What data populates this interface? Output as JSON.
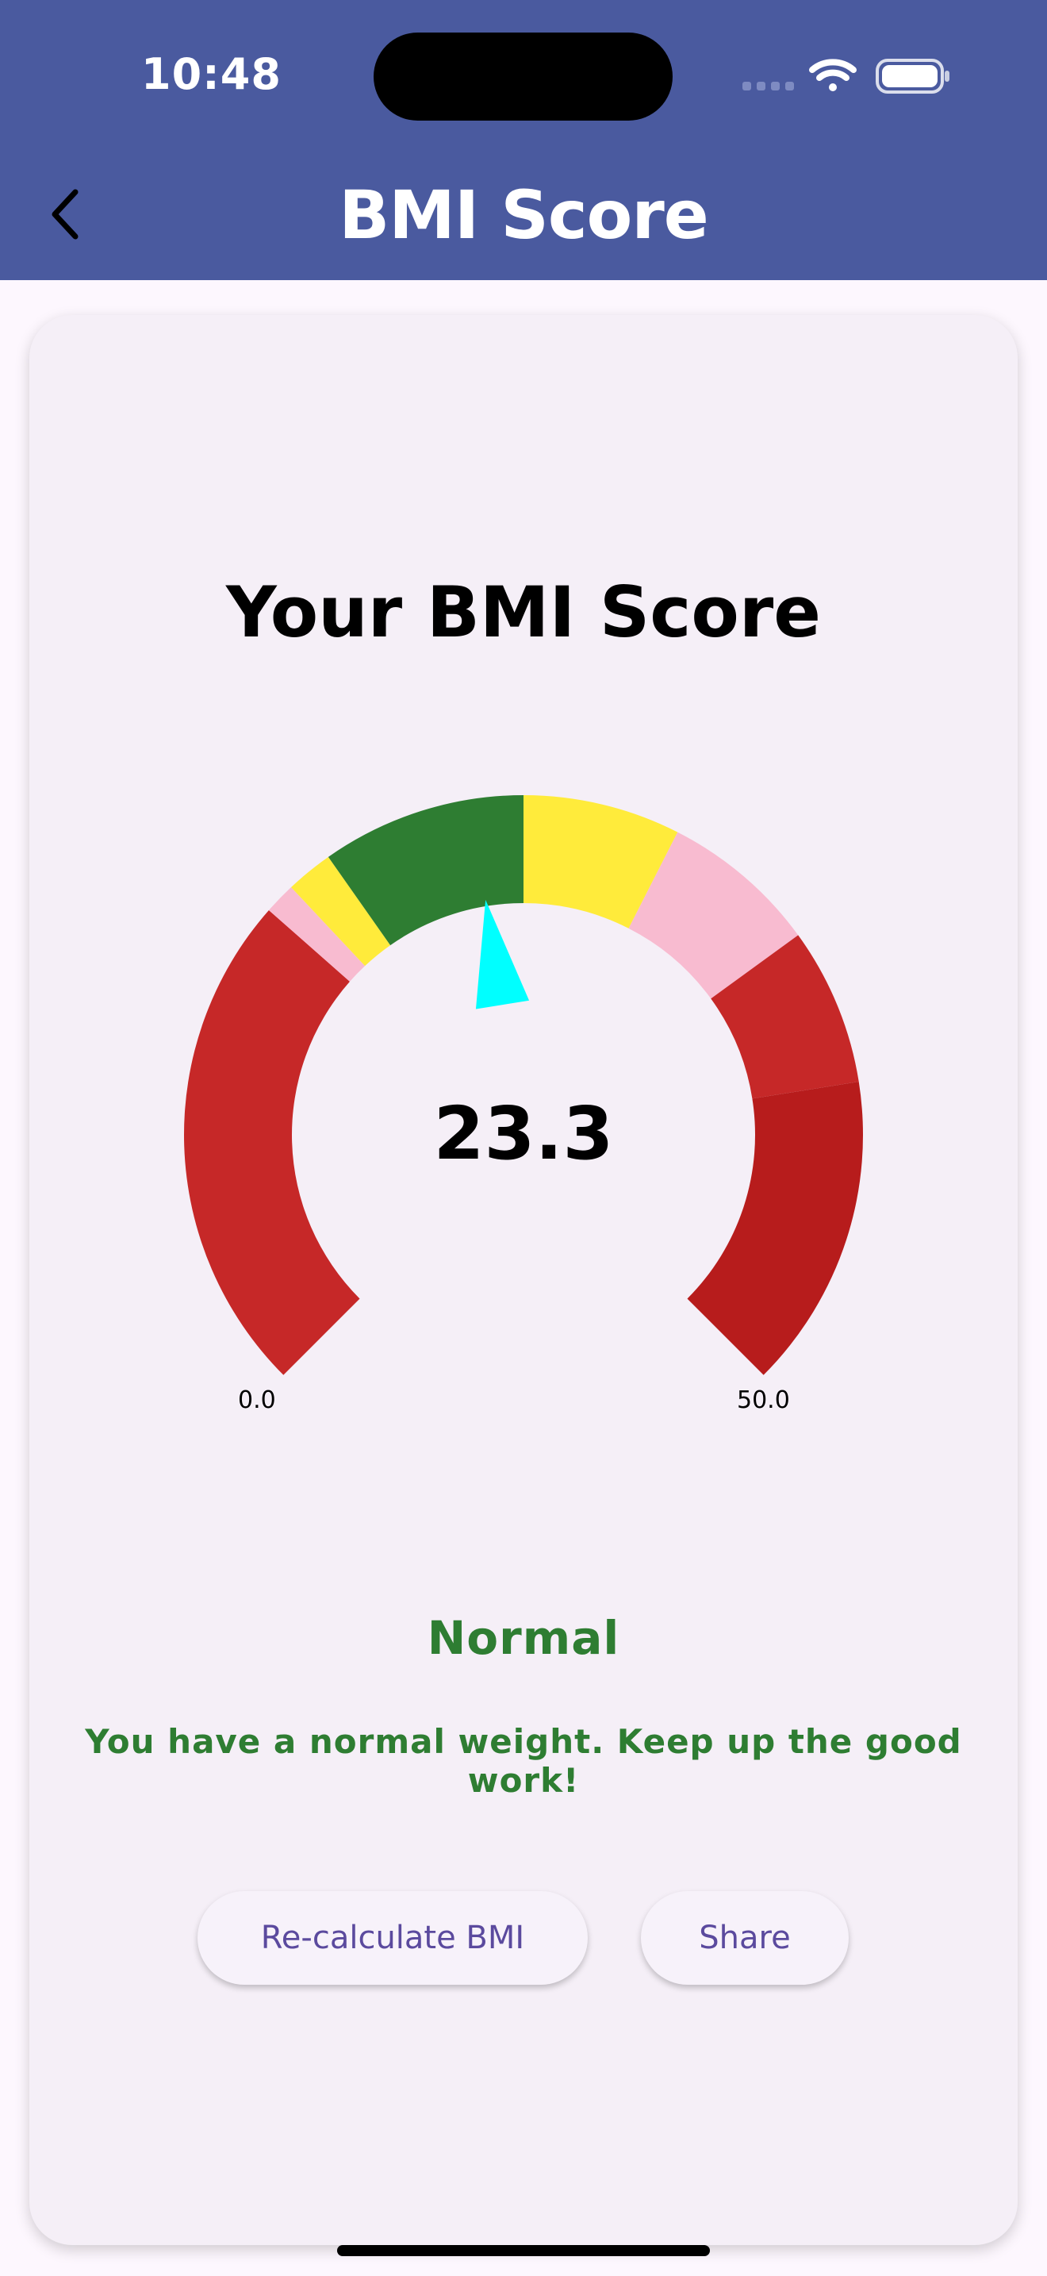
{
  "status_bar": {
    "time": "10:48"
  },
  "header": {
    "title": "BMI Score",
    "back_icon": "chevron-left-icon"
  },
  "result": {
    "heading": "Your BMI Score",
    "score": "23.3",
    "range_min": "0.0",
    "range_max": "50.0",
    "category": "Normal",
    "message": "You have a normal weight. Keep up the good work!"
  },
  "gauge": {
    "min": 0,
    "max": 50,
    "value": 23.3,
    "needle_color": "#00FFFF",
    "bands": [
      {
        "from": 0,
        "to": 16,
        "color": "#C62828"
      },
      {
        "from": 16,
        "to": 17,
        "color": "#F8BBD0"
      },
      {
        "from": 17,
        "to": 18.5,
        "color": "#FFEB3B"
      },
      {
        "from": 18.5,
        "to": 25,
        "color": "#2E7D32"
      },
      {
        "from": 25,
        "to": 30,
        "color": "#FFEB3B"
      },
      {
        "from": 30,
        "to": 35,
        "color": "#F8BBD0"
      },
      {
        "from": 35,
        "to": 40,
        "color": "#C62828"
      },
      {
        "from": 40,
        "to": 50,
        "color": "#B71C1C"
      }
    ]
  },
  "actions": {
    "recalculate_label": "Re-calculate BMI",
    "share_label": "Share"
  },
  "colors": {
    "app_bar": "#4A5A9F",
    "card": "#F5EFF7",
    "category_text": "#2E7D32",
    "button_text": "#5B4A9E"
  }
}
